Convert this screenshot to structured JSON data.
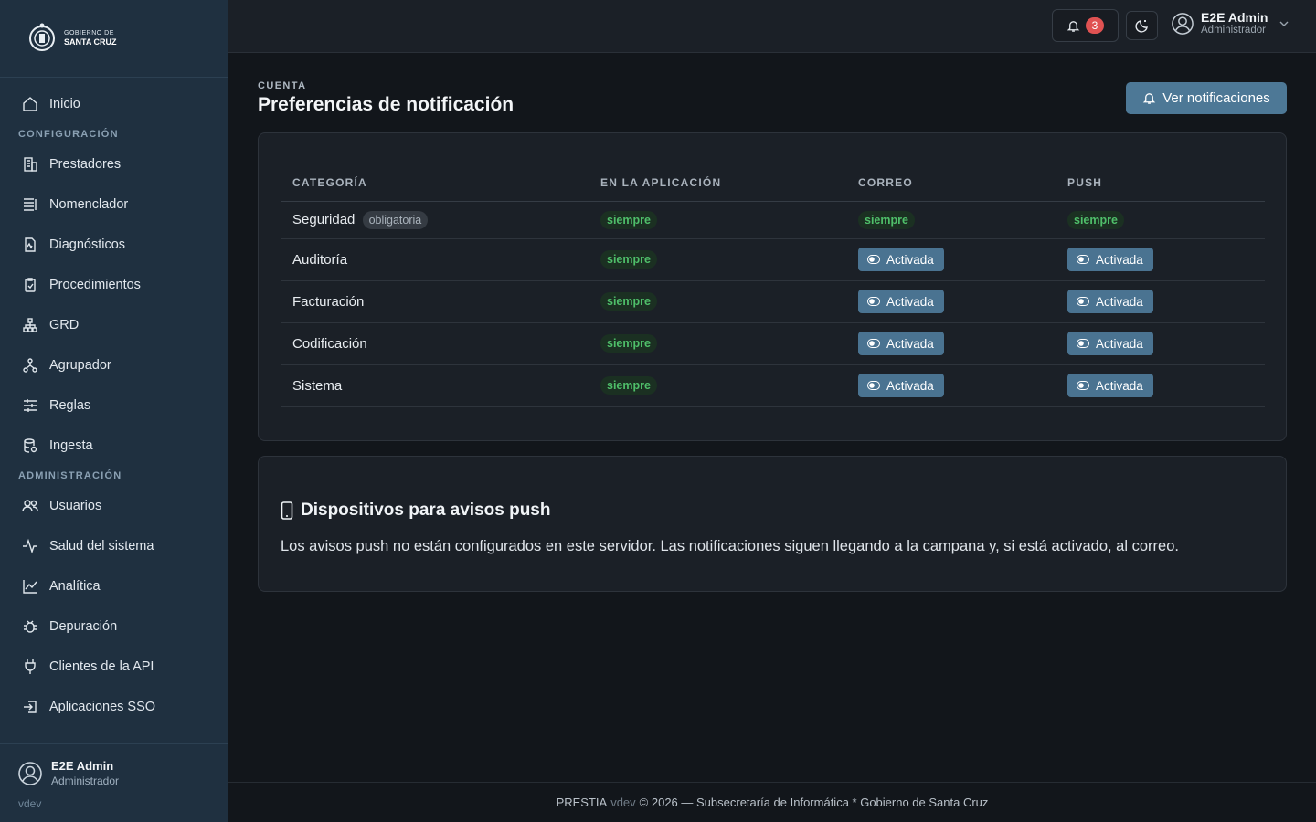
{
  "brand": {
    "line1": "GOBIERNO DE",
    "line2": "SANTA CRUZ"
  },
  "sidebar": {
    "home": "Inicio",
    "section_config": "CONFIGURACIÓN",
    "config_items": [
      {
        "label": "Prestadores",
        "icon": "building-icon"
      },
      {
        "label": "Nomenclador",
        "icon": "list-icon"
      },
      {
        "label": "Diagnósticos",
        "icon": "file-pulse-icon"
      },
      {
        "label": "Procedimientos",
        "icon": "clipboard-check-icon"
      },
      {
        "label": "GRD",
        "icon": "hierarchy-icon"
      },
      {
        "label": "Agrupador",
        "icon": "group-icon"
      },
      {
        "label": "Reglas",
        "icon": "sliders-icon"
      },
      {
        "label": "Ingesta",
        "icon": "database-icon"
      }
    ],
    "section_admin": "ADMINISTRACIÓN",
    "admin_items": [
      {
        "label": "Usuarios",
        "icon": "users-icon"
      },
      {
        "label": "Salud del sistema",
        "icon": "activity-icon"
      },
      {
        "label": "Analítica",
        "icon": "chart-line-icon"
      },
      {
        "label": "Depuración",
        "icon": "bug-icon"
      },
      {
        "label": "Clientes de la API",
        "icon": "plug-icon"
      },
      {
        "label": "Aplicaciones SSO",
        "icon": "login-icon"
      }
    ],
    "user": {
      "name": "E2E Admin",
      "role": "Administrador"
    },
    "version": "vdev"
  },
  "topbar": {
    "notif_count": "3",
    "user": {
      "name": "E2E Admin",
      "role": "Administrador"
    }
  },
  "page": {
    "eyebrow": "CUENTA",
    "title": "Preferencias de notificación",
    "view_button": "Ver notificaciones"
  },
  "prefs": {
    "headers": [
      "CATEGORÍA",
      "EN LA APLICACIÓN",
      "CORREO",
      "PUSH"
    ],
    "mandatory_label": "obligatoria",
    "always_label": "siempre",
    "enabled_label": "Activada",
    "rows": [
      {
        "category": "Seguridad",
        "mandatory": true
      },
      {
        "category": "Auditoría",
        "mandatory": false
      },
      {
        "category": "Facturación",
        "mandatory": false
      },
      {
        "category": "Codificación",
        "mandatory": false
      },
      {
        "category": "Sistema",
        "mandatory": false
      }
    ]
  },
  "push": {
    "title": "Dispositivos para avisos push",
    "text": "Los avisos push no están configurados en este servidor. Las notificaciones siguen llegando a la campana y, si está activado, al correo."
  },
  "footer": {
    "product": "PRESTIA",
    "version": "vdev",
    "rest": "© 2026 — Subsecretaría de Informática * Gobierno de Santa Cruz"
  }
}
